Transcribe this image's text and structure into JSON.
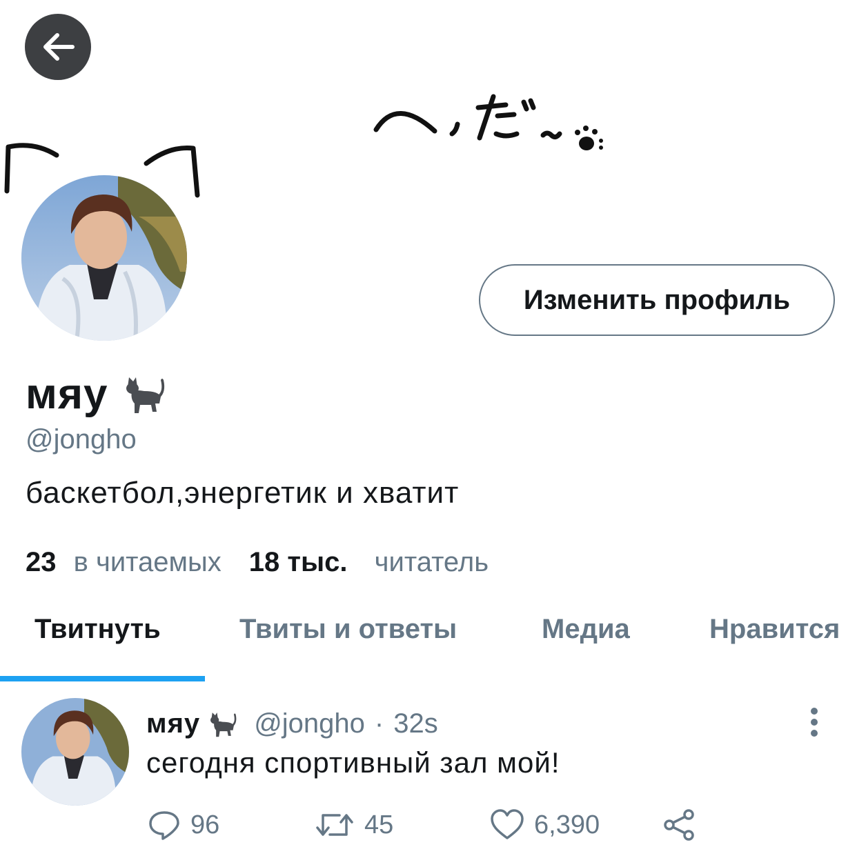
{
  "header": {
    "back_icon": "arrow-left-icon"
  },
  "banner": {
    "decoration": "へっだ～ paw doodle"
  },
  "profile": {
    "edit_label": "Изменить профиль",
    "display_name": "мяу",
    "name_emoji": "cat-icon",
    "handle": "@jongho",
    "bio": "баскетбол,энергетик и хватит",
    "following_count": "23",
    "following_label": "в читаемых",
    "followers_count": "18 тыс.",
    "followers_label": "читатель"
  },
  "tabs": [
    {
      "label": "Твитнуть",
      "active": true
    },
    {
      "label": "Твиты и ответы",
      "active": false
    },
    {
      "label": "Медиа",
      "active": false
    },
    {
      "label": "Нравится",
      "active": false
    }
  ],
  "tweet": {
    "author_name": "мяу",
    "author_handle": "@jongho",
    "separator": "·",
    "time": "32s",
    "text": "сегодня спортивный зал мой!",
    "replies": "96",
    "retweets": "45",
    "likes": "6,390"
  },
  "colors": {
    "accent": "#1da1f2",
    "secondary_text": "#657786",
    "primary_text": "#14171a",
    "back_button_bg": "#3d3f42"
  }
}
